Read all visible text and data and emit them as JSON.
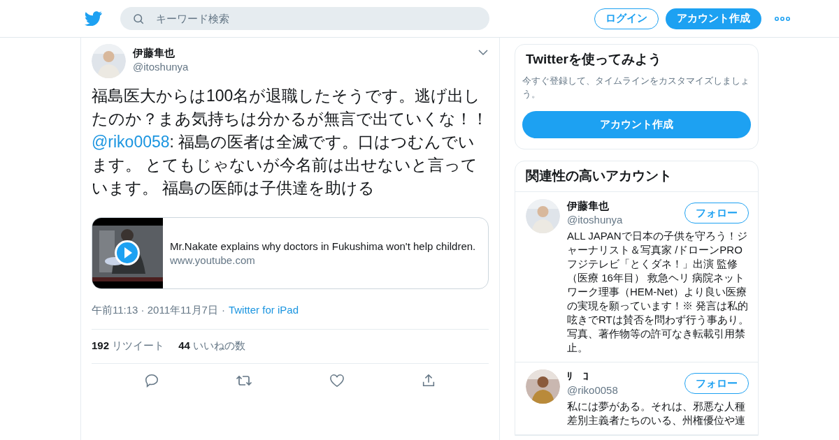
{
  "header": {
    "search": {
      "placeholder": "キーワード検索"
    },
    "login": "ログイン",
    "signup": "アカウント作成"
  },
  "tweet": {
    "name": "伊藤隼也",
    "handle": "@itoshunya",
    "text": "福島医大からは100名が退職したそうです。逃げ出したのか？まあ気持ちは分かるが無言で出ていくな！！",
    "mention": "@riko0058",
    "text_after": ": 福島の医者は全滅です。口はつむんでいます。 とてもじゃないが今名前は出せないと言っています。 福島の医師は子供達を助ける",
    "card": {
      "kind": "picture",
      "title": "Mr.Nakate explains why doctors in Fukushima won't help children.",
      "domain": "www.youtube.com"
    },
    "time": "午前11:13 · 2011年11月7日",
    "sep": "·",
    "source": "Twitter for iPad",
    "stats": [
      {
        "count": "192",
        "label": "リツイート"
      },
      {
        "count": "44",
        "label": "いいねの数"
      }
    ]
  },
  "signup_card": {
    "title": "Twitterを使ってみよう",
    "text": "今すぐ登録して、タイムラインをカスタマイズしましょう。",
    "button": "アカウント作成"
  },
  "related": {
    "title": "関連性の高いアカウント",
    "accounts": [
      {
        "name": "伊藤隼也",
        "handle": "@itoshunya",
        "follow": "フォロー",
        "bio": "ALL JAPANで日本の子供を守ろう！ジャーナリスト＆写真家 /ドローンPRO フジテレビ「とくダネ！」出演 監修（医療 16年目） 救急ヘリ 病院ネットワーク理事（HEM-Net）より良い医療の実現を願っています！※ 発言は私的呟きでRTは賛否を問わず行う事あり。写真、著作物等の許可なき転載引用禁止。"
      },
      {
        "name": "ﾘ　ｺ",
        "handle": "@riko0058",
        "follow": "フォロー",
        "bio": "私には夢がある。それは、邪悪な人種差別主義者たちのいる、州権優位や連"
      }
    ]
  }
}
